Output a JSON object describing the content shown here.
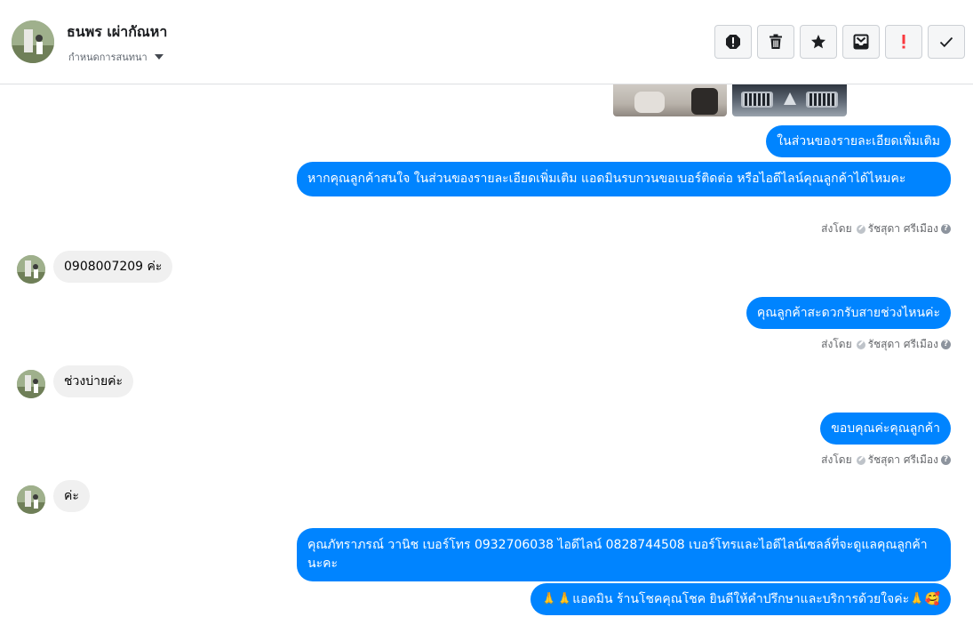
{
  "header": {
    "contact_name": "ธนพร เผ่ากัณหา",
    "assign_label": "กำหนดการสนทนา",
    "actions": [
      "spam-icon",
      "trash-icon",
      "star-icon",
      "move-to-inbox-icon",
      "important-icon",
      "done-icon"
    ]
  },
  "colors": {
    "outgoing_bubble": "#0084ff",
    "incoming_bubble": "#f0f0f0",
    "important_icon": "#fa383e"
  },
  "messages": {
    "m1": "ในส่วนของรายละเอียดเพิ่มเติม",
    "m2": "หากคุณลูกค้าสนใจ ในส่วนของรายละเอียดเพิ่มเติม แอดมินรบกวนขอเบอร์ติดต่อ หรือไอดีไลน์คุณลูกค้าได้ไหมคะ",
    "m3": "0908007209 ค่ะ",
    "m4": "คุณลูกค้าสะดวกรับสายช่วงไหนค่ะ",
    "m5": "ช่วงบ่ายค่ะ",
    "m6": "ขอบคุณค่ะคุณลูกค้า",
    "m7": "ค่ะ",
    "m8": "คุณภัทราภรณ์  วานิช      เบอร์โทร 0932706038  ไอดีไลน์ 0828744508   เบอร์โทรและไอดีไลน์เซลล์ที่จะดูแลคุณลูกค้านะคะ",
    "m9": "🙏🙏แอดมิน ร้านโชคคุณโชค ยินดีให้คำปรึกษาและบริการด้วยใจค่ะ🙏🥰"
  },
  "sent_by": {
    "prefix": "ส่งโดย",
    "agent": "รัชสุดา ศรีเมือง"
  }
}
